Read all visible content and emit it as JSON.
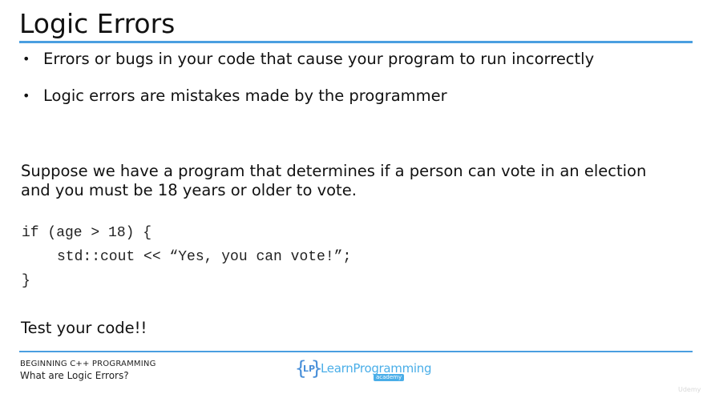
{
  "slide": {
    "title": "Logic Errors",
    "bullets": [
      "Errors or bugs in your code that cause your program to run incorrectly",
      "Logic errors are mistakes made by the programmer"
    ],
    "bullet_glyph": "•",
    "paragraph_line1": "Suppose we have a program that determines if a person can vote in an election",
    "paragraph_line2": "and you must be 18 years or older to vote.",
    "code_lines": [
      "if (age > 18) {",
      "std::cout << “Yes, you can vote!”;",
      "}"
    ],
    "closing_text": "Test your code!!"
  },
  "footer": {
    "course_title": "BEGINNING C++ PROGRAMMING",
    "lecture_title": "What are Logic Errors?",
    "logo": {
      "brace_open": "{",
      "brace_close": "}",
      "initials": "LP",
      "name": "LearnProgramming",
      "tagline": "academy"
    },
    "watermark": "Udemy"
  },
  "colors": {
    "accent_rule": "#4a9fe0",
    "logo_blue": "#4aaee8",
    "text": "#111111"
  }
}
